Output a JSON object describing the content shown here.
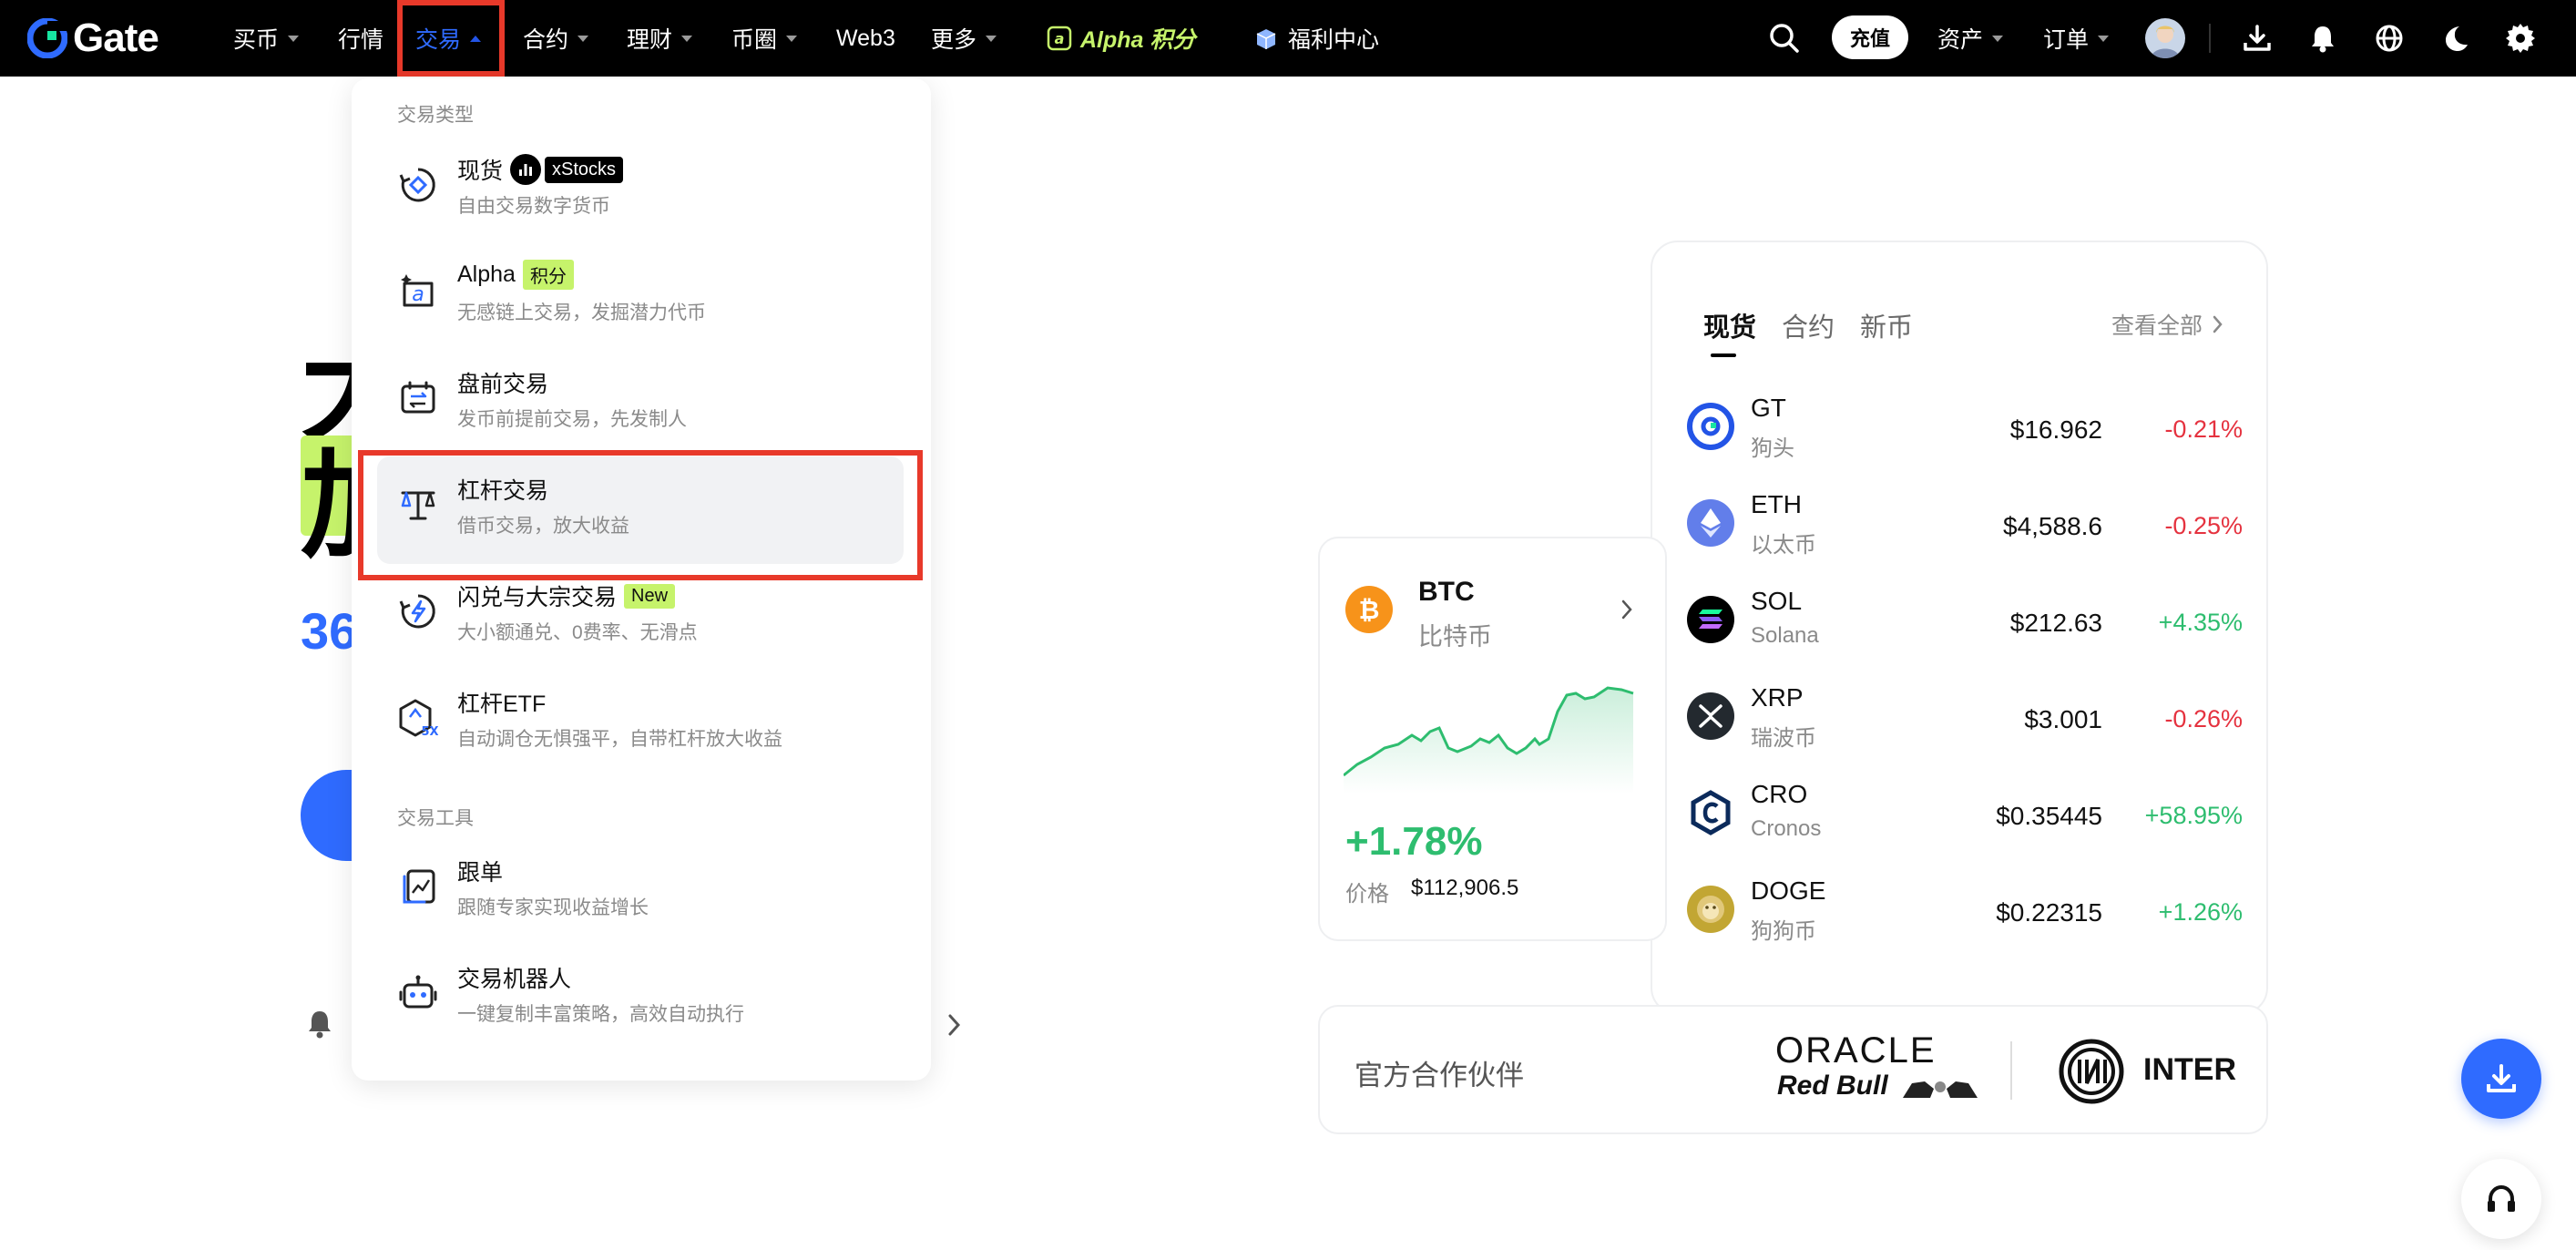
{
  "nav": {
    "logo_text": "Gate",
    "items": [
      {
        "label": "买币",
        "dropdown": true
      },
      {
        "label": "行情",
        "dropdown": false
      },
      {
        "label": "交易",
        "dropdown": true,
        "active": true
      },
      {
        "label": "合约",
        "dropdown": true
      },
      {
        "label": "理财",
        "dropdown": true
      },
      {
        "label": "币圈",
        "dropdown": true
      },
      {
        "label": "Web3",
        "dropdown": false
      },
      {
        "label": "更多",
        "dropdown": true
      }
    ],
    "alpha_label": "Alpha 积分",
    "welfare_label": "福利中心",
    "deposit_label": "充值",
    "assets_label": "资产",
    "orders_label": "订单",
    "icons": [
      "search-icon",
      "avatar",
      "download-icon",
      "bell-icon",
      "globe-icon",
      "moon-icon",
      "gear-icon"
    ]
  },
  "dropdown": {
    "section_trade_types": "交易类型",
    "section_tools": "交易工具",
    "items": [
      {
        "title": "现货",
        "desc": "自由交易数字货币",
        "tag": "xStocks",
        "icon": "spot-icon"
      },
      {
        "title": "Alpha",
        "desc": "无感链上交易，发掘潜力代币",
        "tag": "积分",
        "icon": "alpha-icon"
      },
      {
        "title": "盘前交易",
        "desc": "发币前提前交易，先发制人",
        "icon": "premarket-icon"
      },
      {
        "title": "杠杆交易",
        "desc": "借币交易，放大收益",
        "icon": "margin-icon",
        "highlighted": true
      },
      {
        "title": "闪兑与大宗交易",
        "desc": "大小额通兑、0费率、无滑点",
        "tag": "New",
        "icon": "flash-swap-icon"
      },
      {
        "title": "杠杆ETF",
        "desc": "自动调仓无惧强平，自带杠杆放大收益",
        "icon": "leveraged-etf-icon"
      },
      {
        "title": "跟单",
        "desc": "跟随专家实现收益增长",
        "icon": "copy-trading-icon"
      },
      {
        "title": "交易机器人",
        "desc": "一键复制丰富策略，高效自动执行",
        "icon": "trading-bot-icon"
      }
    ]
  },
  "hero": {
    "char1": "大",
    "char2": "加",
    "num_prefix": "36"
  },
  "btc_card": {
    "symbol": "BTC",
    "name": "比特币",
    "change": "+1.78%",
    "price_label": "价格",
    "price": "$112,906.5",
    "accent": "#f7931a"
  },
  "market": {
    "tabs": [
      "现货",
      "合约",
      "新币"
    ],
    "view_all": "查看全部",
    "rows": [
      {
        "symbol": "GT",
        "name": "狗头",
        "price": "$16.962",
        "change": "-0.21%",
        "dir": "neg",
        "icon": "gt-icon"
      },
      {
        "symbol": "ETH",
        "name": "以太币",
        "price": "$4,588.6",
        "change": "-0.25%",
        "dir": "neg",
        "icon": "eth-icon"
      },
      {
        "symbol": "SOL",
        "name": "Solana",
        "price": "$212.63",
        "change": "+4.35%",
        "dir": "pos",
        "icon": "sol-icon"
      },
      {
        "symbol": "XRP",
        "name": "瑞波币",
        "price": "$3.001",
        "change": "-0.26%",
        "dir": "neg",
        "icon": "xrp-icon"
      },
      {
        "symbol": "CRO",
        "name": "Cronos",
        "price": "$0.35445",
        "change": "+58.95%",
        "dir": "pos",
        "icon": "cro-icon"
      },
      {
        "symbol": "DOGE",
        "name": "狗狗币",
        "price": "$0.22315",
        "change": "+1.26%",
        "dir": "pos",
        "icon": "doge-icon"
      }
    ]
  },
  "partners": {
    "label": "官方合作伙伴",
    "oracle": "ORACLE",
    "redbull": "Red Bull",
    "inter": "INTER"
  },
  "colors": {
    "accent_blue": "#2f6bff",
    "positive": "#2ebd6f",
    "negative": "#e5323f",
    "highlight_red": "#e8392a",
    "tag_green": "#c6f36b"
  }
}
